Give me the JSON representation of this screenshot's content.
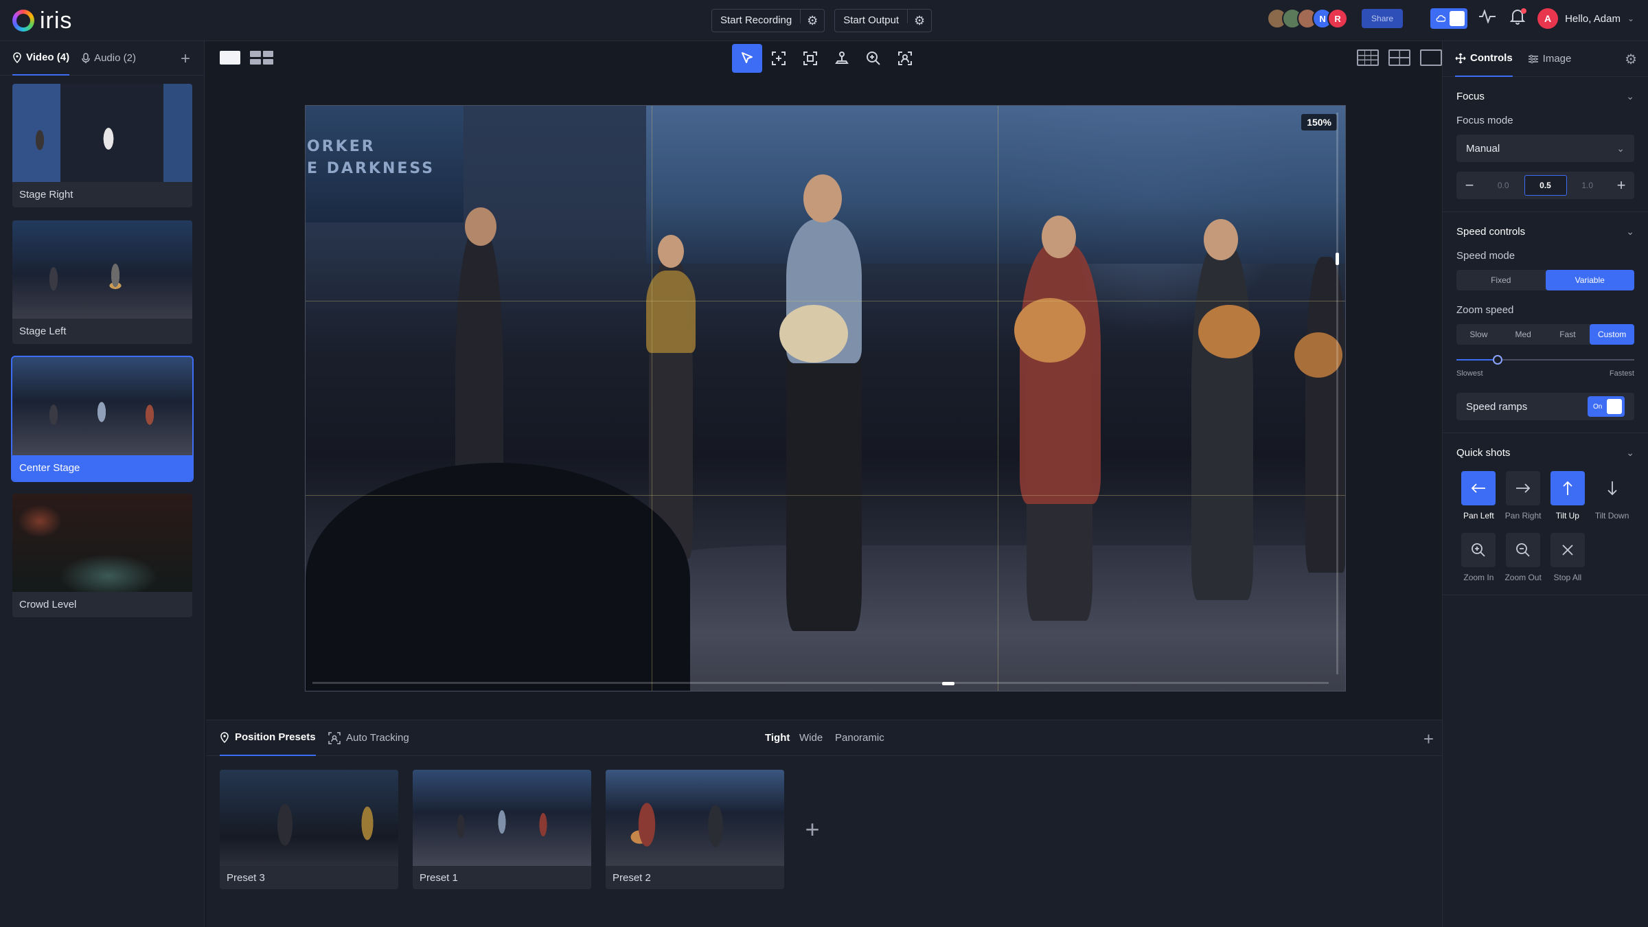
{
  "app": {
    "name": "iris"
  },
  "header": {
    "start_recording": "Start Recording",
    "start_output": "Start Output",
    "avatars": [
      {
        "initial": "",
        "color": "#8a6a4a"
      },
      {
        "initial": "",
        "color": "#5a7a5a"
      },
      {
        "initial": "",
        "color": "#a36b53"
      },
      {
        "initial": "N",
        "color": "#3d6cf5"
      },
      {
        "initial": "R",
        "color": "#e8364f"
      }
    ],
    "share": "Share",
    "greeting": "Hello, Adam",
    "user_initial": "A"
  },
  "sources": {
    "tabs": [
      {
        "label": "Video (4)"
      },
      {
        "label": "Audio (2)"
      }
    ],
    "cameras": [
      {
        "name": "Stage Right"
      },
      {
        "name": "Stage Left"
      },
      {
        "name": "Center Stage"
      },
      {
        "name": "Crowd Level"
      }
    ]
  },
  "viewer": {
    "zoom": "150%",
    "backdrop_text": "ORKER\nE DARKNESS"
  },
  "presets": {
    "tabs": [
      {
        "label": "Position Presets"
      },
      {
        "label": "Auto Tracking"
      }
    ],
    "filters": [
      "Tight",
      "Wide",
      "Panoramic"
    ],
    "items": [
      {
        "name": "Preset 3"
      },
      {
        "name": "Preset 1"
      },
      {
        "name": "Preset 2"
      }
    ]
  },
  "controls": {
    "tabs": [
      {
        "label": "Controls"
      },
      {
        "label": "Image"
      }
    ],
    "focus": {
      "title": "Focus",
      "mode_label": "Focus mode",
      "mode_value": "Manual",
      "values": [
        "0.0",
        "0.5",
        "1.0"
      ]
    },
    "speed": {
      "title": "Speed controls",
      "mode_label": "Speed mode",
      "modes": [
        "Fixed",
        "Variable"
      ],
      "zoom_label": "Zoom speed",
      "zoom_options": [
        "Slow",
        "Med",
        "Fast",
        "Custom"
      ],
      "slider_value": 0.23,
      "slider_min": "Slowest",
      "slider_max": "Fastest",
      "ramps_label": "Speed ramps",
      "ramps_state": "On"
    },
    "quick_shots": {
      "title": "Quick shots",
      "items": [
        {
          "label": "Pan Left",
          "icon": "arrow-left-icon"
        },
        {
          "label": "Pan Right",
          "icon": "arrow-right-icon"
        },
        {
          "label": "Tilt Up",
          "icon": "arrow-up-icon"
        },
        {
          "label": "Tilt Down",
          "icon": "arrow-down-icon"
        },
        {
          "label": "Zoom In",
          "icon": "zoom-in-icon"
        },
        {
          "label": "Zoom Out",
          "icon": "zoom-out-icon"
        },
        {
          "label": "Stop All",
          "icon": "close-icon"
        }
      ]
    }
  },
  "colors": {
    "accent": "#3d6cf5",
    "background": "#161a23",
    "panel": "#1b1f29"
  }
}
